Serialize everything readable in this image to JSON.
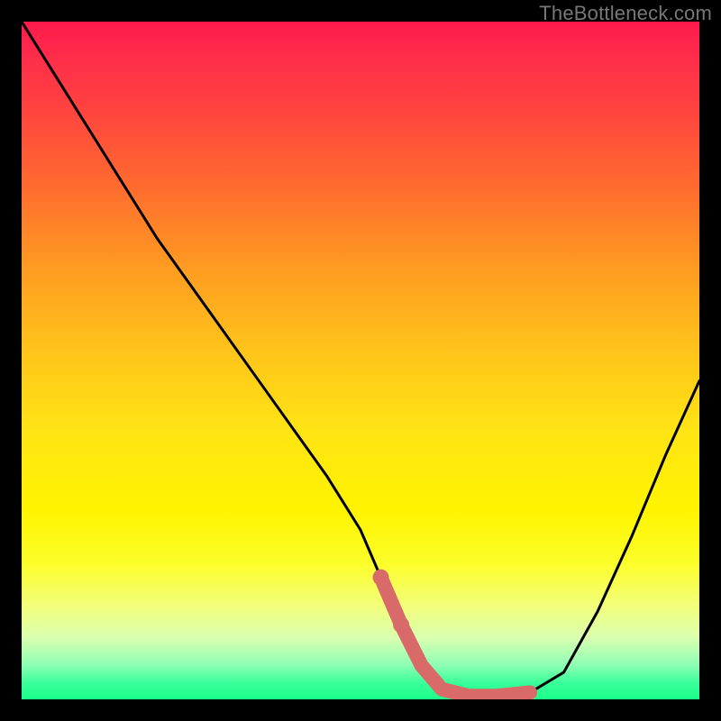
{
  "watermark": "TheBottleneck.com",
  "colors": {
    "background": "#000000",
    "curve": "#000000",
    "overlay": "#d86a6a",
    "gradient_top": "#ff1a4d",
    "gradient_bottom": "#1aff8c"
  },
  "chart_data": {
    "type": "line",
    "title": "",
    "xlabel": "",
    "ylabel": "",
    "xlim": [
      0,
      100
    ],
    "ylim": [
      0,
      100
    ],
    "grid": false,
    "legend": false,
    "series": [
      {
        "name": "bottleneck-curve",
        "x": [
          0,
          5,
          10,
          15,
          20,
          25,
          30,
          35,
          40,
          45,
          50,
          53,
          56,
          59,
          62,
          66,
          70,
          75,
          80,
          85,
          90,
          95,
          100
        ],
        "values": [
          100,
          92,
          84,
          76,
          68,
          61,
          54,
          47,
          40,
          33,
          25,
          18,
          11,
          5,
          1.5,
          0.5,
          0.5,
          1,
          4,
          13,
          24,
          36,
          47
        ]
      }
    ],
    "overlay_segment": {
      "name": "optimal-range-highlight",
      "color": "#d86a6a",
      "x": [
        53,
        56,
        59,
        62,
        66,
        70,
        75
      ],
      "values": [
        18,
        11,
        5,
        1.5,
        0.5,
        0.5,
        1
      ]
    },
    "overlay_dots": {
      "name": "optimal-markers",
      "color": "#d86a6a",
      "points": [
        {
          "x": 53,
          "y": 18
        },
        {
          "x": 56,
          "y": 11
        }
      ]
    }
  }
}
